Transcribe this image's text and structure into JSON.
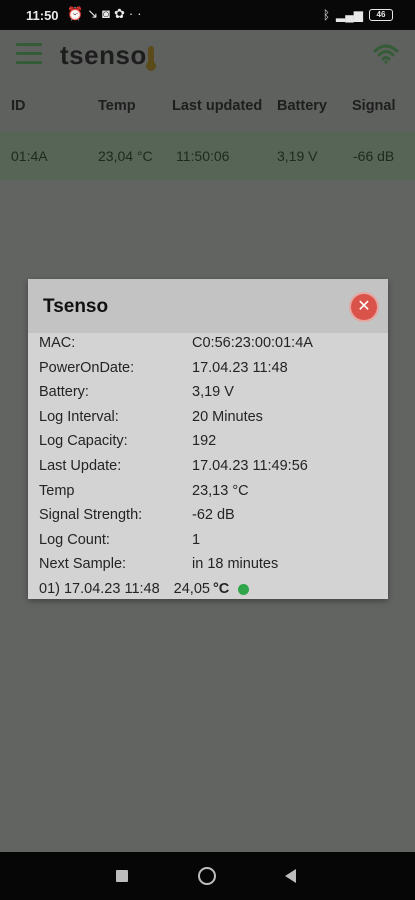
{
  "status_bar": {
    "time": "11:50",
    "left_icons": [
      "alarm-icon",
      "missed-call-icon",
      "gamepad-icon",
      "app-icon",
      "more-dots-icon"
    ],
    "battery": "46"
  },
  "app": {
    "logo_text": "tsenso",
    "accent_color": "#355c36"
  },
  "table": {
    "headers": [
      "ID",
      "Temp",
      "Last updated",
      "Battery",
      "Signal"
    ],
    "rows": [
      {
        "id": "01:4A",
        "temp": "23,04 °C",
        "updated": "11:50:06",
        "battery": "3,19 V",
        "signal": "-66 dB"
      }
    ]
  },
  "dialog": {
    "title": "Tsenso",
    "close_icon": "close-icon",
    "rows": [
      {
        "label": "MAC:",
        "value": "C0:56:23:00:01:4A"
      },
      {
        "label": "PowerOnDate:",
        "value": "17.04.23 11:48"
      },
      {
        "label": "Battery:",
        "value": "3,19 V"
      },
      {
        "label": "Log Interval:",
        "value": "20 Minutes"
      },
      {
        "label": "Log Capacity:",
        "value": "192"
      },
      {
        "label": "Last Update:",
        "value": "17.04.23 11:49:56"
      },
      {
        "label": "Temp",
        "value": "23,13 °C"
      },
      {
        "label": "Signal Strength:",
        "value": "-62 dB"
      },
      {
        "label": "Log Count:",
        "value": "1"
      },
      {
        "label": "Next Sample:",
        "value": "in 18 minutes"
      }
    ],
    "log_entry": {
      "index_time": "01) 17.04.23 11:48",
      "temp": "24,05",
      "unit": "°C",
      "status_color": "#2fa64a"
    }
  }
}
